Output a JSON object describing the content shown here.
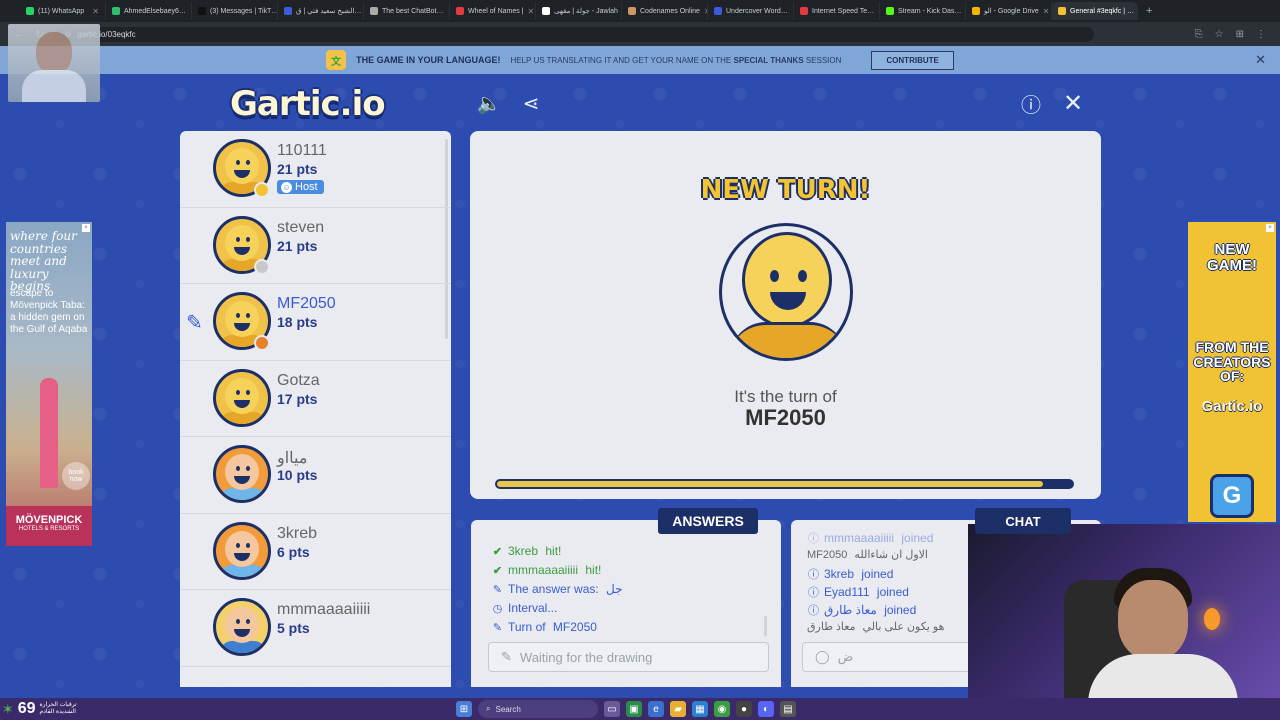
{
  "browser": {
    "tabs": [
      {
        "label": "(11) WhatsApp",
        "color": "#25d366"
      },
      {
        "label": "AhmedElsebaey6…",
        "color": "#2fbf71"
      },
      {
        "label": "(3) Messages | TikT…",
        "color": "#111111"
      },
      {
        "label": "الشيخ سعيد فتي | ق…",
        "color": "#3b5bdb"
      },
      {
        "label": "The best ChatBot…",
        "color": "#aaaaaa"
      },
      {
        "label": "Wheel of Names |",
        "color": "#e23b3b"
      },
      {
        "label": "جولة | مقهى - Jawlah",
        "color": "#ffffff"
      },
      {
        "label": "Codenames Online",
        "color": "#c96"
      },
      {
        "label": "Undercover Word…",
        "color": "#3b5bdb"
      },
      {
        "label": "Internet Speed Te…",
        "color": "#e23b3b"
      },
      {
        "label": "Stream - Kick Das…",
        "color": "#53fc18"
      },
      {
        "label": "الو - Google Drive",
        "color": "#f4b400"
      },
      {
        "label": "General #3eqkfc | …",
        "color": "#f1c334"
      }
    ],
    "url": "gartic.io/03eqkfc"
  },
  "banner": {
    "main": "THE GAME IN YOUR LANGUAGE!",
    "sub_prefix": "HELP US TRANSLATING IT AND GET YOUR NAME ON THE",
    "sub_highlight": "SPECIAL THANKS",
    "sub_suffix": "SESSION",
    "contribute": "CONTRIBUTE"
  },
  "game": {
    "logo": "Gartic.io",
    "players": [
      {
        "name": "110111",
        "pts": "21 pts",
        "host": "Host",
        "dot": "#f1c334",
        "style": "plain"
      },
      {
        "name": "steven",
        "pts": "21 pts",
        "dot": "#c8c8c8",
        "style": "plain"
      },
      {
        "name": "MF2050",
        "pts": "18 pts",
        "dot": "#e8822a",
        "style": "plain",
        "drawing": true
      },
      {
        "name": "Gotza",
        "pts": "17 pts",
        "style": "plain"
      },
      {
        "name": "ميااو",
        "pts": "10 pts",
        "style": "hair-orange"
      },
      {
        "name": "3kreb",
        "pts": "6 pts",
        "style": "hair-orange"
      },
      {
        "name": "mmmaaaaiiiii",
        "pts": "5 pts",
        "style": "hair-blonde"
      }
    ],
    "new_turn": "NEW TURN!",
    "turn_of_label": "It's the turn of",
    "turn_player": "MF2050",
    "timer_progress": 0.95
  },
  "answers": {
    "tab_label": "ANSWERS",
    "messages": [
      {
        "type": "hit",
        "icon": "check",
        "name": "3kreb",
        "text": " hit!"
      },
      {
        "type": "hit",
        "icon": "check",
        "name": "mmmaaaaiiiii",
        "text": " hit!"
      },
      {
        "type": "sys",
        "icon": "pencil",
        "text": "The answer was: ",
        "value": "جل"
      },
      {
        "type": "sys",
        "icon": "clock",
        "text": "Interval..."
      },
      {
        "type": "sys",
        "icon": "pencil",
        "text": "Turn of ",
        "value": "MF2050"
      }
    ],
    "placeholder": "Waiting for the drawing"
  },
  "chat": {
    "tab_label": "CHAT",
    "messages": [
      {
        "type": "sys",
        "name": "mmmaaaaiiiii",
        "text": " joined",
        "faded": true
      },
      {
        "type": "plain",
        "text": "MF2050 ",
        "value": "الاول ان شاءالله"
      },
      {
        "type": "sys",
        "name": "3kreb",
        "text": " joined"
      },
      {
        "type": "sys",
        "name": "Eyad111",
        "text": " joined"
      },
      {
        "type": "sys",
        "name": "معاذ طارق",
        "text": " joined"
      },
      {
        "type": "plain",
        "text": "معاذ طارق ",
        "value": "هو يكون على بالي"
      }
    ],
    "placeholder": "ض"
  },
  "ads": {
    "left_headline": "where four countries meet and luxury begins",
    "left_body": "escape to Mövenpick Taba: a hidden gem on the Gulf of Aqaba",
    "left_book": "book now",
    "left_brand": "MÖVENPICK",
    "left_brand_sub": "HOTELS & RESORTS",
    "right_line1": "NEW GAME!",
    "right_line2": "FROM THE CREATORS OF:",
    "right_line3": "Gartic.io",
    "right_button": "G"
  },
  "taskbar": {
    "temp": "69",
    "weather_label": "ترقبات الحرارة الشديدة القادم",
    "search": "Search"
  }
}
